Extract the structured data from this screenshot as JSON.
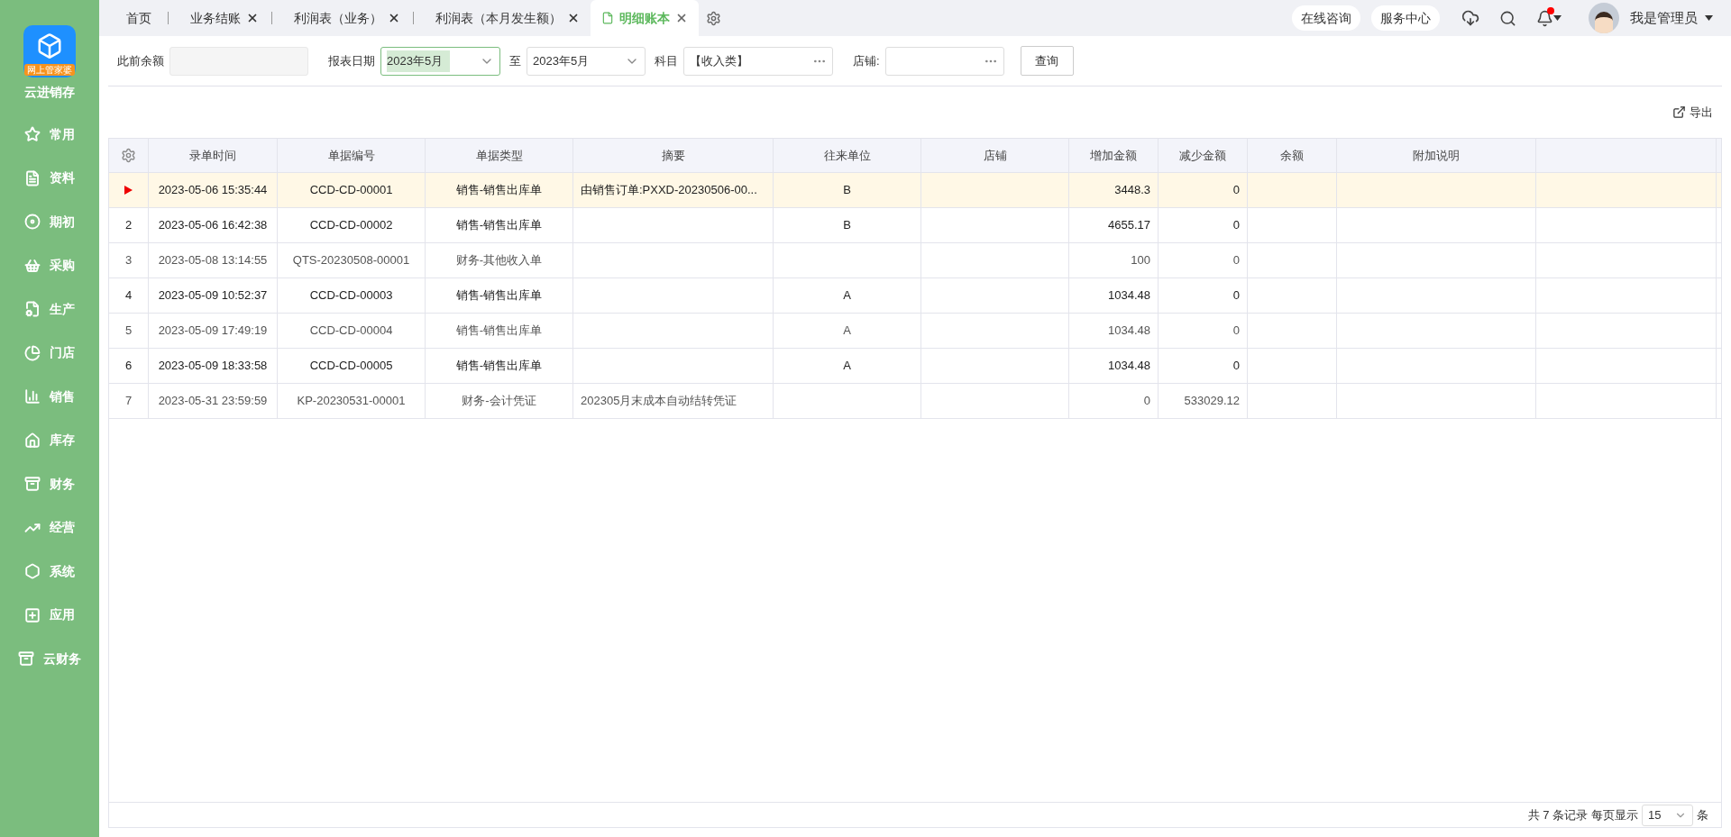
{
  "sidebar": {
    "logo_badge": "网上管家婆",
    "app_name": "云进销存",
    "items": [
      {
        "label": "常用",
        "kind": "star"
      },
      {
        "label": "资料",
        "kind": "doc"
      },
      {
        "label": "期初",
        "kind": "disc"
      },
      {
        "label": "采购",
        "kind": "cart"
      },
      {
        "label": "生产",
        "kind": "file"
      },
      {
        "label": "门店",
        "kind": "pie"
      },
      {
        "label": "销售",
        "kind": "bars"
      },
      {
        "label": "库存",
        "kind": "house"
      },
      {
        "label": "财务",
        "kind": "box"
      },
      {
        "label": "经营",
        "kind": "trend"
      },
      {
        "label": "系统",
        "kind": "hex"
      },
      {
        "label": "应用",
        "kind": "plus"
      },
      {
        "label": "云财务",
        "kind": "box"
      }
    ]
  },
  "tabs": [
    {
      "label": "首页",
      "closable": false,
      "selected": false
    },
    {
      "label": "业务结账",
      "closable": true,
      "selected": false
    },
    {
      "label": "利润表（业务）",
      "closable": true,
      "selected": false
    },
    {
      "label": "利润表（本月发生额）",
      "closable": true,
      "selected": false
    },
    {
      "label": "明细账本",
      "closable": true,
      "selected": true
    }
  ],
  "header_actions": [
    "在线咨询",
    "服务中心"
  ],
  "notifications": {
    "unread": true
  },
  "user": {
    "name": "我是管理员"
  },
  "filters": {
    "balance_label": "此前余额",
    "date_label": "报表日期",
    "date_from": "2023年5月",
    "date_sep": "至",
    "date_to": "2023年5月",
    "subject_label": "科目",
    "subject": "【收入类】",
    "store_label": "店铺:",
    "query_button": "查询"
  },
  "export_button": "导出",
  "table": {
    "columns": [
      {
        "label": "录单时间"
      },
      {
        "label": "单据编号"
      },
      {
        "label": "单据类型"
      },
      {
        "label": "摘要"
      },
      {
        "label": "往来单位"
      },
      {
        "label": "店铺"
      },
      {
        "label": "增加金额"
      },
      {
        "label": "减少金额"
      },
      {
        "label": "余额"
      },
      {
        "label": "附加说明"
      }
    ],
    "rows": [
      {
        "selected": true,
        "muted": false,
        "cells": [
          "2023-05-06 15:35:44",
          "CCD-CD-00001",
          "销售-销售出库单",
          "由销售订单:PXXD-20230506-00...",
          "B",
          null,
          "3448.3",
          "0",
          null,
          null
        ]
      },
      {
        "index": "2",
        "selected": false,
        "muted": false,
        "cells": [
          "2023-05-06 16:42:38",
          "CCD-CD-00002",
          "销售-销售出库单",
          null,
          "B",
          null,
          "4655.17",
          "0",
          null,
          null
        ]
      },
      {
        "index": "3",
        "selected": false,
        "muted": true,
        "cells": [
          "2023-05-08 13:14:55",
          "QTS-20230508-00001",
          "财务-其他收入单",
          null,
          null,
          null,
          "100",
          "0",
          null,
          null
        ]
      },
      {
        "index": "4",
        "selected": false,
        "muted": false,
        "cells": [
          "2023-05-09 10:52:37",
          "CCD-CD-00003",
          "销售-销售出库单",
          null,
          "A",
          null,
          "1034.48",
          "0",
          null,
          null
        ]
      },
      {
        "index": "5",
        "selected": false,
        "muted": true,
        "cells": [
          "2023-05-09 17:49:19",
          "CCD-CD-00004",
          "销售-销售出库单",
          null,
          "A",
          null,
          "1034.48",
          "0",
          null,
          null
        ]
      },
      {
        "index": "6",
        "selected": false,
        "muted": false,
        "cells": [
          "2023-05-09 18:33:58",
          "CCD-CD-00005",
          "销售-销售出库单",
          null,
          "A",
          null,
          "1034.48",
          "0",
          null,
          null
        ]
      },
      {
        "index": "7",
        "selected": false,
        "muted": true,
        "cells": [
          "2023-05-31 23:59:59",
          "KP-20230531-00001",
          "财务-会计凭证",
          "202305月末成本自动结转凭证",
          null,
          null,
          "0",
          "533029.12",
          null,
          null
        ]
      }
    ]
  },
  "pager": {
    "total": "共 7 条记录",
    "per_page_label": "每页显示",
    "per_page": "15",
    "unit": "条"
  }
}
